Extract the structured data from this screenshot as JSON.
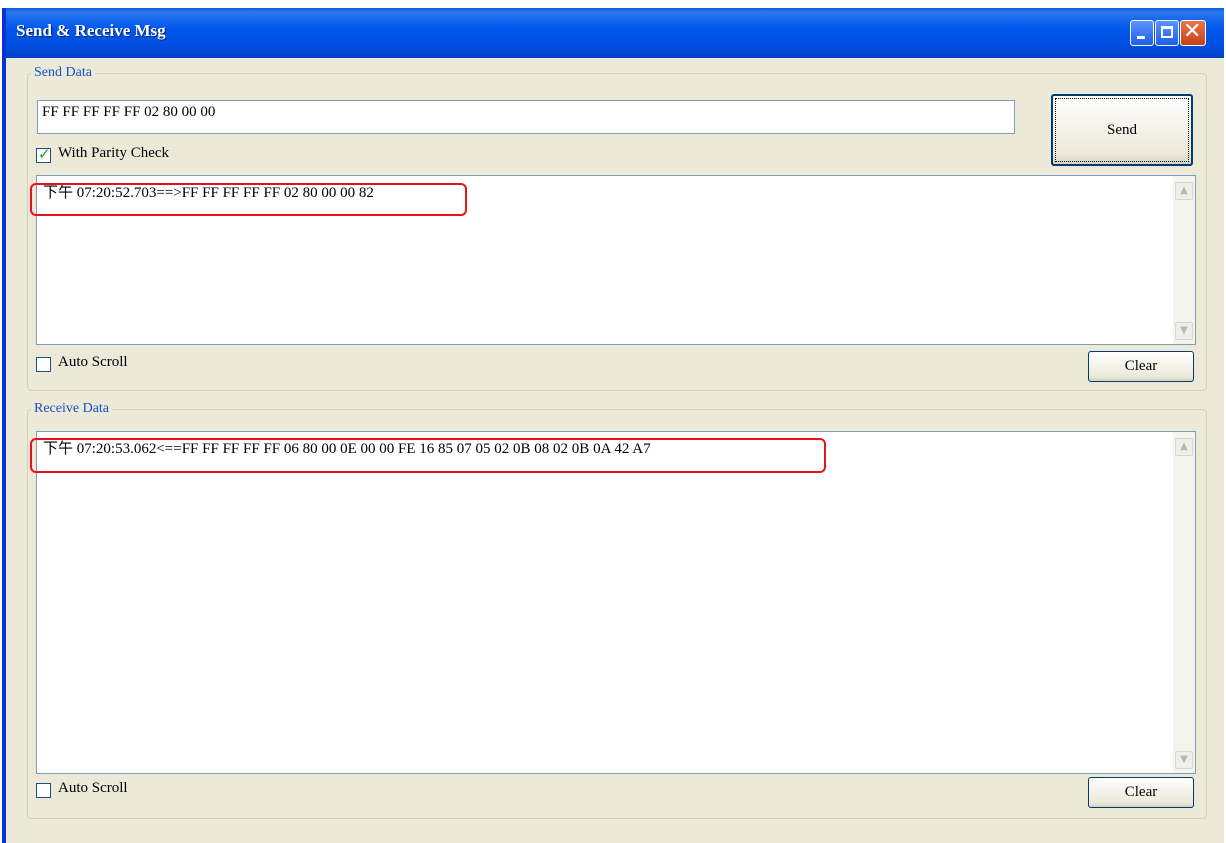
{
  "window": {
    "title": "Send & Receive Msg"
  },
  "send_group": {
    "label": "Send Data",
    "input_value": "FF FF FF FF FF 02 80 00 00",
    "send_label": "Send",
    "parity_label": "With Parity Check",
    "parity_checked": true,
    "log_line": "下午 07:20:52.703==>FF FF FF FF FF 02 80 00 00 82",
    "auto_scroll_label": "Auto Scroll",
    "auto_scroll_checked": false,
    "clear_label": "Clear"
  },
  "receive_group": {
    "label": "Receive Data",
    "log_line": "下午 07:20:53.062<==FF FF FF FF FF 06 80 00 0E 00 00 FE 16 85 07 05 02 0B 08 02 0B 0A 42 A7",
    "auto_scroll_label": "Auto Scroll",
    "auto_scroll_checked": false,
    "clear_label": "Clear"
  },
  "colors": {
    "titlebar": "#0054e3",
    "highlight": "#e8121c",
    "group_label": "#1450c8",
    "window_bg": "#ece9d8"
  }
}
